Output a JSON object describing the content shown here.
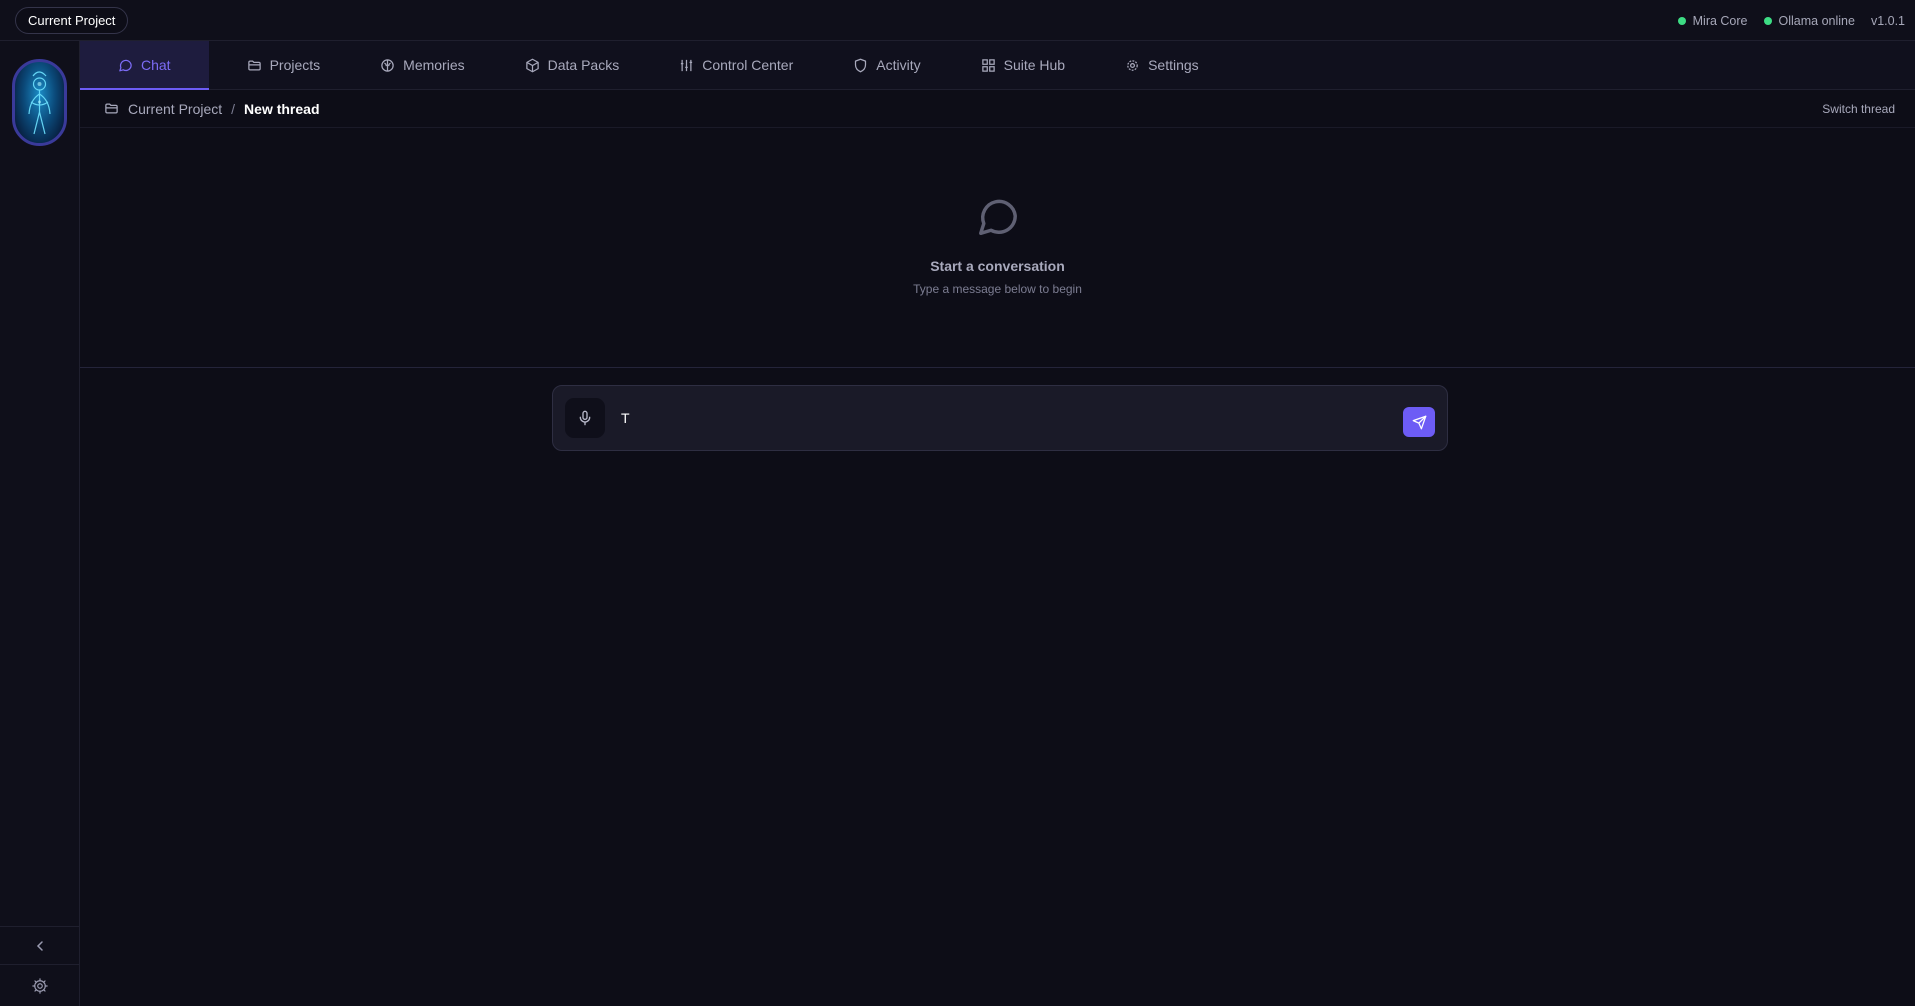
{
  "topbar": {
    "project_label": "Current Project",
    "status": [
      {
        "label": "Mira Core",
        "color": "#3ddc84"
      },
      {
        "label": "Ollama online",
        "color": "#3ddc84"
      }
    ],
    "version": "v1.0.1"
  },
  "nav": {
    "tabs": [
      {
        "label": "Chat",
        "icon": "chat-icon",
        "active": true
      },
      {
        "label": "Projects",
        "icon": "folder-icon"
      },
      {
        "label": "Memories",
        "icon": "brain-icon"
      },
      {
        "label": "Data Packs",
        "icon": "package-icon"
      },
      {
        "label": "Control Center",
        "icon": "sliders-icon"
      },
      {
        "label": "Activity",
        "icon": "shield-icon"
      },
      {
        "label": "Suite Hub",
        "icon": "grid-icon"
      },
      {
        "label": "Settings",
        "icon": "gear-icon"
      }
    ]
  },
  "breadcrumb": {
    "project": "Current Project",
    "separator": "/",
    "thread": "New thread",
    "switch_label": "Switch thread"
  },
  "empty": {
    "title": "Start a conversation",
    "subtitle": "Type a message below to begin"
  },
  "composer": {
    "value": "T",
    "mic_icon": "microphone-icon",
    "send_icon": "send-icon"
  },
  "theme": {
    "accent": "#6d5cf5",
    "status_green": "#3ddc84",
    "background": "#0d0d17"
  }
}
